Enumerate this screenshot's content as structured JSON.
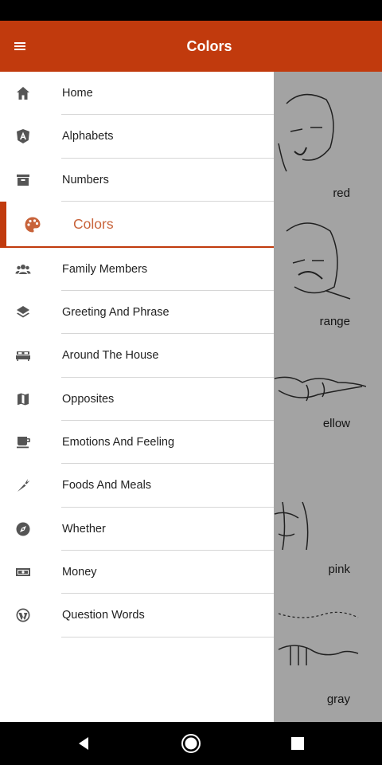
{
  "app_bar": {
    "title": "Colors"
  },
  "drawer": {
    "items": [
      {
        "label": "Home"
      },
      {
        "label": "Alphabets"
      },
      {
        "label": "Numbers"
      },
      {
        "label": "Colors"
      },
      {
        "label": "Family Members"
      },
      {
        "label": "Greeting And Phrase"
      },
      {
        "label": "Around The House"
      },
      {
        "label": "Opposites"
      },
      {
        "label": "Emotions And Feeling"
      },
      {
        "label": "Foods And Meals"
      },
      {
        "label": "Whether"
      },
      {
        "label": "Money"
      },
      {
        "label": "Question Words"
      }
    ],
    "active_index": 3
  },
  "content": {
    "signs": [
      {
        "label": "red"
      },
      {
        "label": "range"
      },
      {
        "label": "ellow"
      },
      {
        "label": "pink"
      },
      {
        "label": "gray"
      }
    ]
  },
  "colors": {
    "primary": "#c13a0d",
    "active_text": "#c8633a",
    "icon_gray": "#555555"
  },
  "icons": {
    "menu": "hamburger-icon",
    "items": [
      "home-icon",
      "angular-icon",
      "archive-icon",
      "palette-icon",
      "group-icon",
      "layers-icon",
      "bed-icon",
      "map-icon",
      "cup-icon",
      "carrot-icon",
      "compass-icon",
      "money-icon",
      "wordpress-icon"
    ]
  }
}
